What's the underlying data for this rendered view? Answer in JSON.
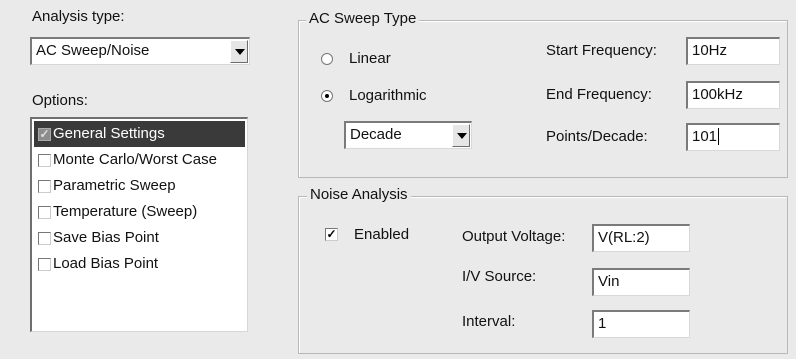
{
  "analysis_type": {
    "label": "Analysis type:",
    "selected": "AC Sweep/Noise"
  },
  "options": {
    "label": "Options:",
    "items": [
      {
        "label": "General Settings",
        "checked": true,
        "selected": true
      },
      {
        "label": "Monte Carlo/Worst Case",
        "checked": false,
        "selected": false
      },
      {
        "label": "Parametric Sweep",
        "checked": false,
        "selected": false
      },
      {
        "label": "Temperature (Sweep)",
        "checked": false,
        "selected": false
      },
      {
        "label": "Save Bias Point",
        "checked": false,
        "selected": false
      },
      {
        "label": "Load Bias Point",
        "checked": false,
        "selected": false
      }
    ]
  },
  "ac_sweep": {
    "legend": "AC Sweep Type",
    "linear_label": "Linear",
    "log_label": "Logarithmic",
    "selected_type": "Logarithmic",
    "log_scale": "Decade",
    "start_label": "Start Frequency:",
    "start_value": "10Hz",
    "end_label": "End Frequency:",
    "end_value": "100kHz",
    "points_label": "Points/Decade:",
    "points_value": "101"
  },
  "noise": {
    "legend": "Noise Analysis",
    "enabled_label": "Enabled",
    "enabled": true,
    "output_label": "Output Voltage:",
    "output_value": "V(RL:2)",
    "source_label": "I/V Source:",
    "source_value": "Vin",
    "interval_label": "Interval:",
    "interval_value": "1"
  },
  "colors": {
    "background": "#eaeaea",
    "selection": "#3a3a3a"
  }
}
